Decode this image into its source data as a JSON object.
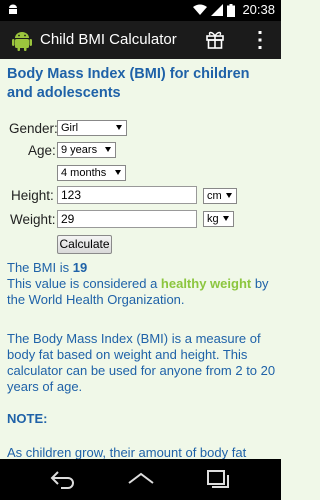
{
  "status_bar": {
    "time": "20:38",
    "icons": [
      "android-icon",
      "wifi-icon",
      "signal-icon",
      "battery-icon"
    ]
  },
  "action_bar": {
    "title": "Child BMI Calculator",
    "icons": [
      "app-logo-icon",
      "gift-icon",
      "overflow-menu-icon"
    ]
  },
  "content": {
    "heading": "Body Mass Index (BMI) for children and adolescents",
    "form": {
      "gender_label": "Gender:",
      "gender_value": "Girl",
      "age_label": "Age:",
      "age_years_value": "9 years",
      "age_months_value": "4 months",
      "height_label": "Height:",
      "height_value": "123",
      "height_unit": "cm",
      "weight_label": "Weight:",
      "weight_value": "29",
      "weight_unit": "kg",
      "calculate_label": "Calculate"
    },
    "result": {
      "bmi_prefix": "The BMI is ",
      "bmi_value": "19",
      "line2_prefix": "This value is considered a ",
      "category": "healthy weight",
      "line2_suffix": " by the World Health Organization."
    },
    "description": "The Body Mass Index (BMI) is a measure of body fat based on weight and height. This calculator can be used for anyone from 2 to 20 years of age.",
    "note_title": "NOTE:",
    "note_text": "As children grow, their amount of body fat"
  },
  "nav_bar": {
    "icons": [
      "back-icon",
      "home-icon",
      "recents-icon"
    ]
  },
  "colors": {
    "heading": "#1f62a8",
    "healthy": "#8cc63f",
    "background": "#f0f8e8"
  }
}
